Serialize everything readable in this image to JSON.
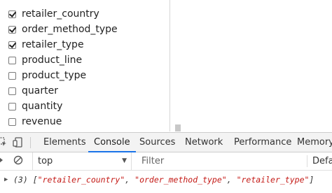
{
  "checklist": {
    "items": [
      {
        "label": "retailer_country",
        "checked": true
      },
      {
        "label": "order_method_type",
        "checked": true
      },
      {
        "label": "retailer_type",
        "checked": true
      },
      {
        "label": "product_line",
        "checked": false
      },
      {
        "label": "product_type",
        "checked": false
      },
      {
        "label": "quarter",
        "checked": false
      },
      {
        "label": "quantity",
        "checked": false
      },
      {
        "label": "revenue",
        "checked": false
      }
    ]
  },
  "devtools": {
    "tabs": [
      "Elements",
      "Console",
      "Sources",
      "Network",
      "Performance",
      "Memory"
    ],
    "active_tab": "Console",
    "accent_color": "#1a73e8",
    "context": "top",
    "filter_placeholder": "Filter",
    "levels": "Defa",
    "console_output": {
      "count": "(3)",
      "open_bracket": "[",
      "values": [
        "\"retailer_country\"",
        "\"order_method_type\"",
        "\"retailer_type\""
      ],
      "separator": ", ",
      "close_bracket": "]",
      "string_color": "#c41a16"
    },
    "icons": [
      "inspect-icon",
      "device-toolbar-icon",
      "console-sidebar-icon",
      "clear-console-icon",
      "expand-arrow-icon"
    ]
  }
}
